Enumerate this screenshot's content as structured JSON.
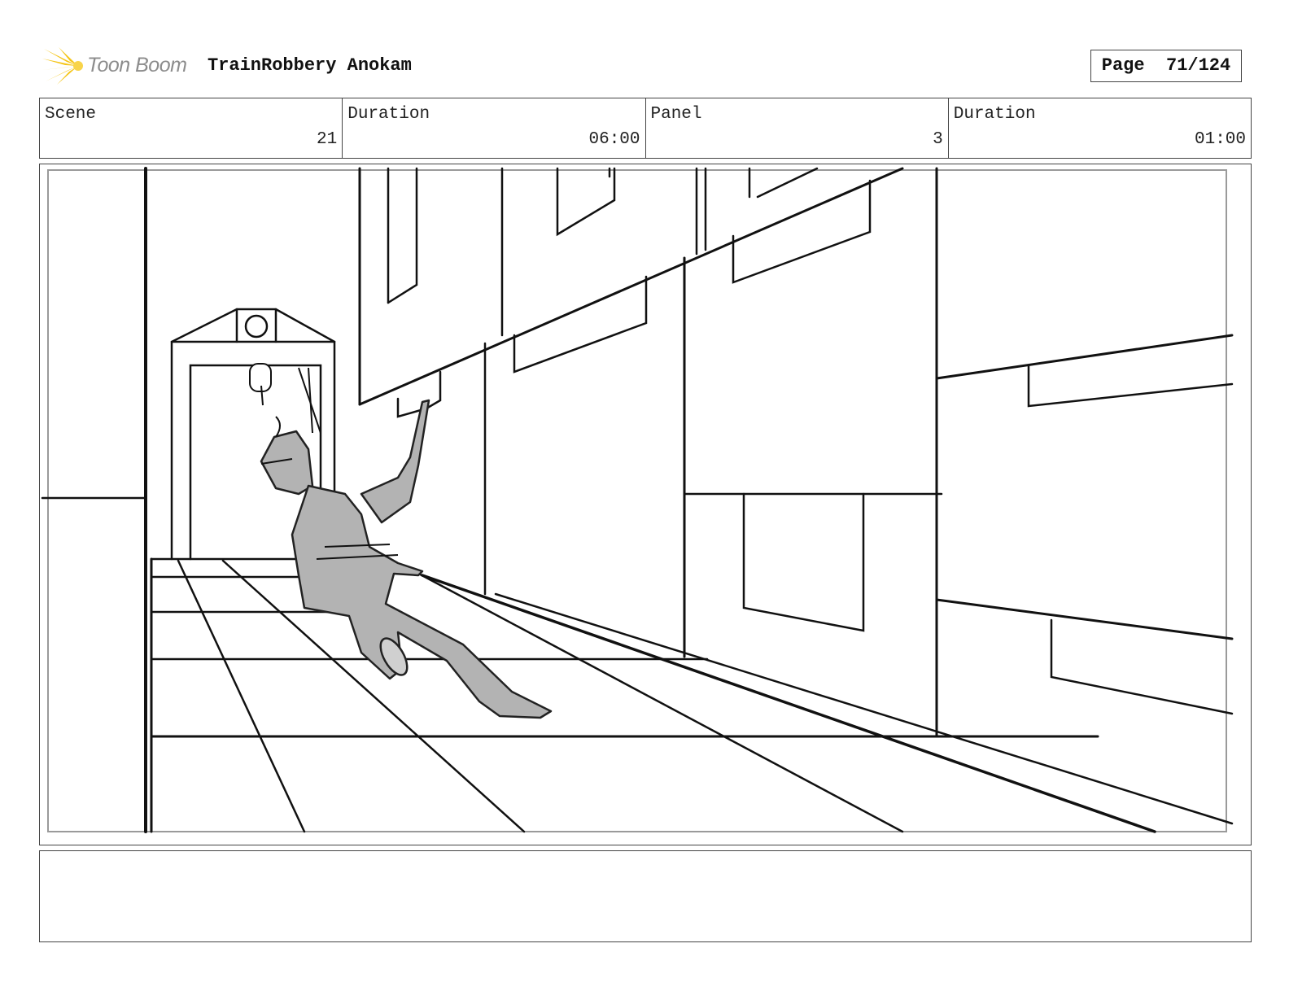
{
  "header": {
    "logo_text": "Toon Boom",
    "project_title": "TrainRobbery Anokam",
    "page_label": "Page",
    "page_number": "71/124"
  },
  "info": {
    "scene_label": "Scene",
    "scene_value": "21",
    "scene_duration_label": "Duration",
    "scene_duration_value": "06:00",
    "panel_label": "Panel",
    "panel_value": "3",
    "panel_duration_label": "Duration",
    "panel_duration_value": "01:00"
  },
  "icons": {
    "logo": "toon-boom-starburst-icon"
  },
  "colors": {
    "logo_yellow": "#f5c518",
    "sketch_fill": "#b3b3b3",
    "line": "#111111"
  }
}
